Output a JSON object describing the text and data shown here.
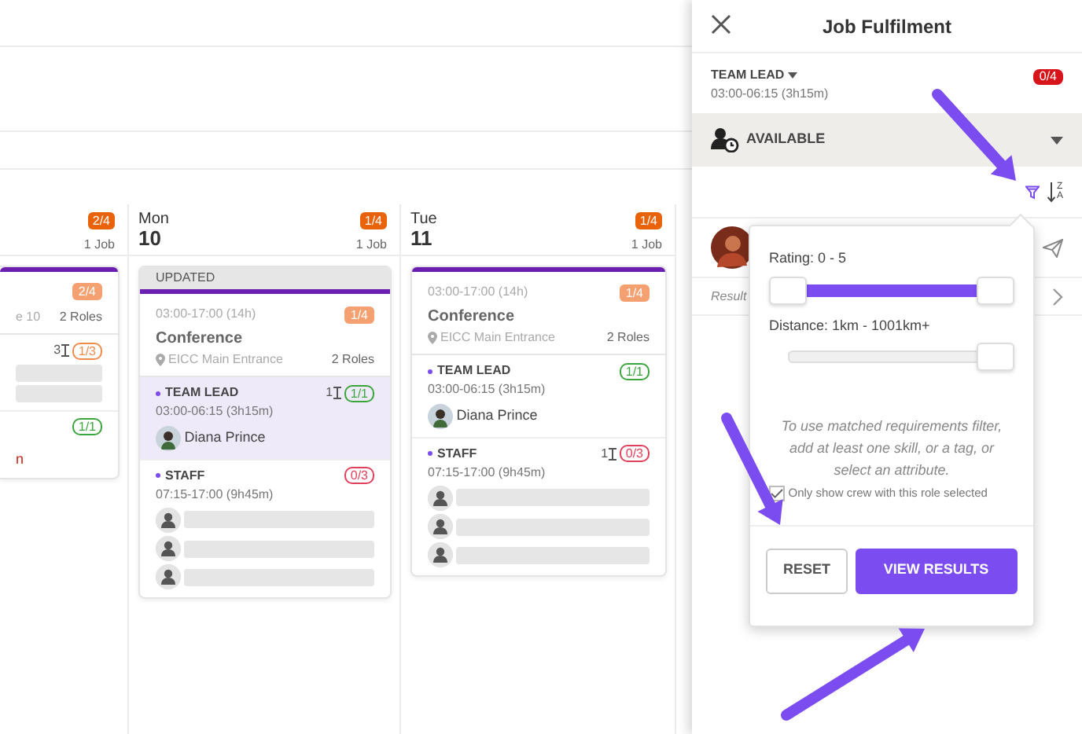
{
  "calendar": {
    "days": [
      {
        "cut_left": true,
        "badge": "2/4",
        "jobs": "1 Job",
        "card": {
          "badge": "2/4",
          "location": "e 10",
          "roles_label": "2 Roles",
          "roles": [
            {
              "selected": false,
              "count": "3",
              "badge": "1/3",
              "color": "#f08a4b",
              "crew": [
                {
                  "kind": "empty"
                },
                {
                  "kind": "empty"
                }
              ]
            },
            {
              "selected": false,
              "badge": "1/1",
              "color": "#3aa53a",
              "crew": [
                {
                  "kind": "note",
                  "text": "n"
                }
              ]
            }
          ]
        }
      },
      {
        "cut_left": false,
        "day": "Mon",
        "date": "10",
        "badge": "1/4",
        "jobs": "1 Job",
        "card": {
          "updated": "UPDATED",
          "time": "03:00-17:00 (14h)",
          "badge": "1/4",
          "title": "Conference",
          "location": "EICC Main Entrance",
          "roles_label": "2 Roles",
          "roles": [
            {
              "name": "TEAM LEAD",
              "selected": true,
              "count": "1",
              "badge": "1/1",
              "color": "#3aa53a",
              "time": "03:00-06:15 (3h15m)",
              "crew": [
                {
                  "kind": "person",
                  "name": "Diana Prince"
                }
              ]
            },
            {
              "name": "STAFF",
              "selected": false,
              "badge": "0/3",
              "color": "#e0405a",
              "time": "07:15-17:00 (9h45m)",
              "crew": [
                {
                  "kind": "empty"
                },
                {
                  "kind": "empty"
                },
                {
                  "kind": "empty"
                }
              ]
            }
          ]
        }
      },
      {
        "cut_left": false,
        "day": "Tue",
        "date": "11",
        "badge": "1/4",
        "jobs": "1 Job",
        "card": {
          "time": "03:00-17:00 (14h)",
          "badge": "1/4",
          "title": "Conference",
          "location": "EICC Main Entrance",
          "roles_label": "2 Roles",
          "roles": [
            {
              "name": "TEAM LEAD",
              "selected": false,
              "badge": "1/1",
              "color": "#3aa53a",
              "time": "03:00-06:15 (3h15m)",
              "crew": [
                {
                  "kind": "person",
                  "name": "Diana Prince"
                }
              ]
            },
            {
              "name": "STAFF",
              "selected": false,
              "count": "1",
              "badge": "0/3",
              "color": "#e0405a",
              "time": "07:15-17:00 (9h45m)",
              "crew": [
                {
                  "kind": "empty"
                },
                {
                  "kind": "empty"
                },
                {
                  "kind": "empty"
                }
              ]
            }
          ]
        }
      }
    ]
  },
  "panel": {
    "title": "Job Fulfilment",
    "role": "TEAM LEAD",
    "role_time": "03:00-06:15 (3h15m)",
    "badge": "0/4",
    "availability": "AVAILABLE",
    "sort": {
      "top": "Z",
      "bottom": "A"
    },
    "results_label": "Result",
    "filter": {
      "sliders": [
        {
          "label": "Rating: 0 - 5",
          "kind": "range",
          "level": 1
        },
        {
          "label": "Distance: 1km - 1001km+",
          "kind": "single",
          "level": 1
        }
      ],
      "hint": "To use matched requirements filter, add at least one skill, or a tag, or select an attribute.",
      "checkbox": {
        "label": "Only show crew with this role selected",
        "checked": true
      },
      "buttons": [
        {
          "label": "RESET",
          "kind": "secondary"
        },
        {
          "label": "VIEW RESULTS",
          "kind": "primary"
        }
      ]
    }
  }
}
